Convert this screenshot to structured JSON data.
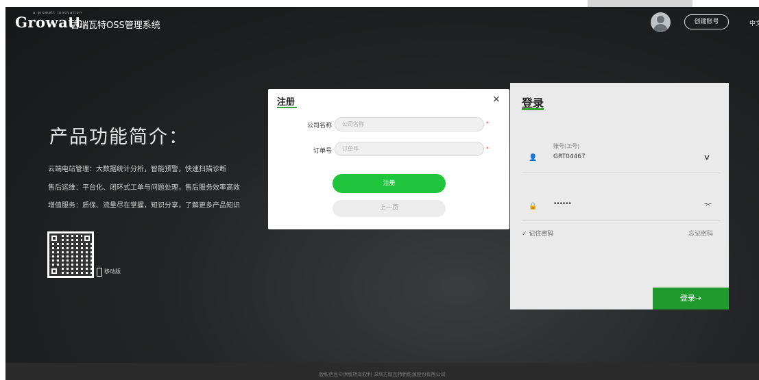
{
  "header": {
    "logo": "Growatt",
    "logo_tagline": "a growatt innovation",
    "system_title": "古瑞瓦特OSS管理系统",
    "create_account": "创建账号",
    "language": "中文"
  },
  "intro": {
    "title": "产品功能简介：",
    "lines": [
      "云端电站管理：大数据统计分析，智能预警，快速扫描诊断",
      "售后运维：平台化、闭环式工单与问题处理，售后服务效率高效",
      "增值服务：质保、流量尽在掌握，知识分享，了解更多产品知识"
    ],
    "mobile_label": "移动版"
  },
  "login": {
    "title": "登录",
    "account_label": "账号(工号)",
    "account_value": "GRT04467",
    "password_value": "••••••",
    "remember": "记住密码",
    "forgot": "忘记密码",
    "submit": "登录→"
  },
  "register_modal": {
    "title": "注册",
    "close": "×",
    "company_label": "公司名称",
    "company_placeholder": "公司名称",
    "order_label": "订单号",
    "order_placeholder": "订单号",
    "required_mark": "*",
    "submit": "注册",
    "back": "上一页"
  },
  "footer": {
    "copyright": "版权信息©保留所有权利 深圳古瑞瓦特新能源股份有限公司"
  }
}
